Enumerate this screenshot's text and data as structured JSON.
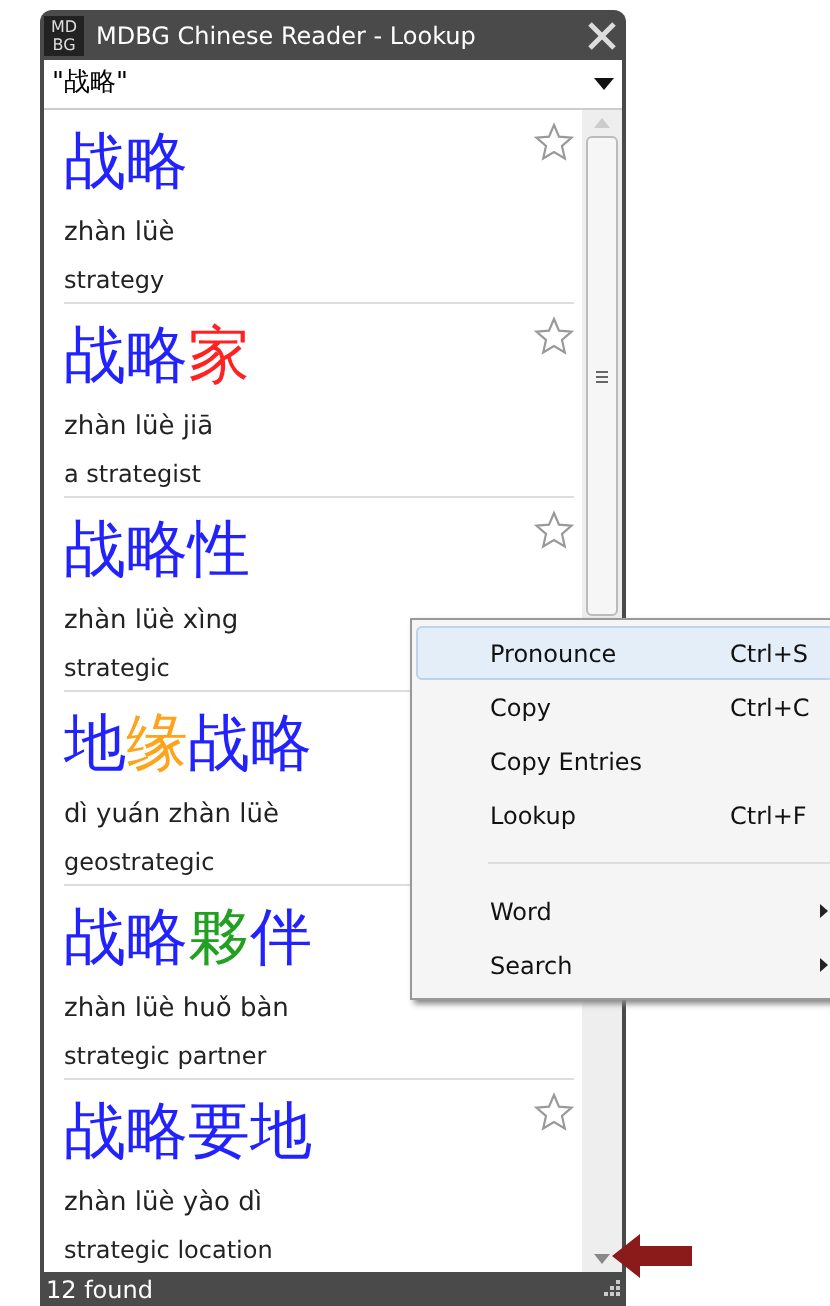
{
  "window": {
    "title": "MDBG Chinese Reader - Lookup",
    "logo": "MD BG"
  },
  "search": {
    "value": "\"战略\""
  },
  "entries": [
    {
      "headword": [
        {
          "text": "战略",
          "color": "#2222ff"
        }
      ],
      "pinyin": "zhàn lüè",
      "definition": "strategy",
      "star": true
    },
    {
      "headword": [
        {
          "text": "战略",
          "color": "#2222ff"
        },
        {
          "text": "家",
          "color": "#ff2222"
        }
      ],
      "pinyin": "zhàn lüè jiā",
      "definition": "a strategist",
      "star": true
    },
    {
      "headword": [
        {
          "text": "战略性",
          "color": "#2222ff"
        }
      ],
      "pinyin": "zhàn lüè xìng",
      "definition": "strategic",
      "star": true
    },
    {
      "headword": [
        {
          "text": "地",
          "color": "#2222ff"
        },
        {
          "text": "缘",
          "color": "#ffa31a"
        },
        {
          "text": "战略",
          "color": "#2222ff"
        }
      ],
      "pinyin": "dì yuán zhàn lüè",
      "definition": "geostrategic"
    },
    {
      "headword": [
        {
          "text": "战略",
          "color": "#2222ff"
        },
        {
          "text": "夥",
          "color": "#22a022"
        },
        {
          "text": "伴",
          "color": "#2222ff"
        }
      ],
      "pinyin": "zhàn lüè huǒ bàn",
      "definition": "strategic partner"
    },
    {
      "headword": [
        {
          "text": "战略要地",
          "color": "#2222ff"
        }
      ],
      "pinyin": "zhàn lüè yào dì",
      "definition": "strategic location",
      "star": true
    }
  ],
  "status_bar": {
    "text": "12 found"
  },
  "context_menu": [
    {
      "kind": "item",
      "label": "Pronounce",
      "shortcut": "Ctrl+S",
      "selected": true
    },
    {
      "kind": "item",
      "label": "Copy",
      "shortcut": "Ctrl+C",
      "selected": false
    },
    {
      "kind": "item",
      "label": "Copy Entries",
      "selected": false
    },
    {
      "kind": "item",
      "label": "Lookup",
      "shortcut": "Ctrl+F",
      "selected": false
    },
    {
      "kind": "separator"
    },
    {
      "kind": "submenu",
      "label": "Word",
      "selected": false
    },
    {
      "kind": "submenu",
      "label": "Search",
      "selected": false
    }
  ]
}
